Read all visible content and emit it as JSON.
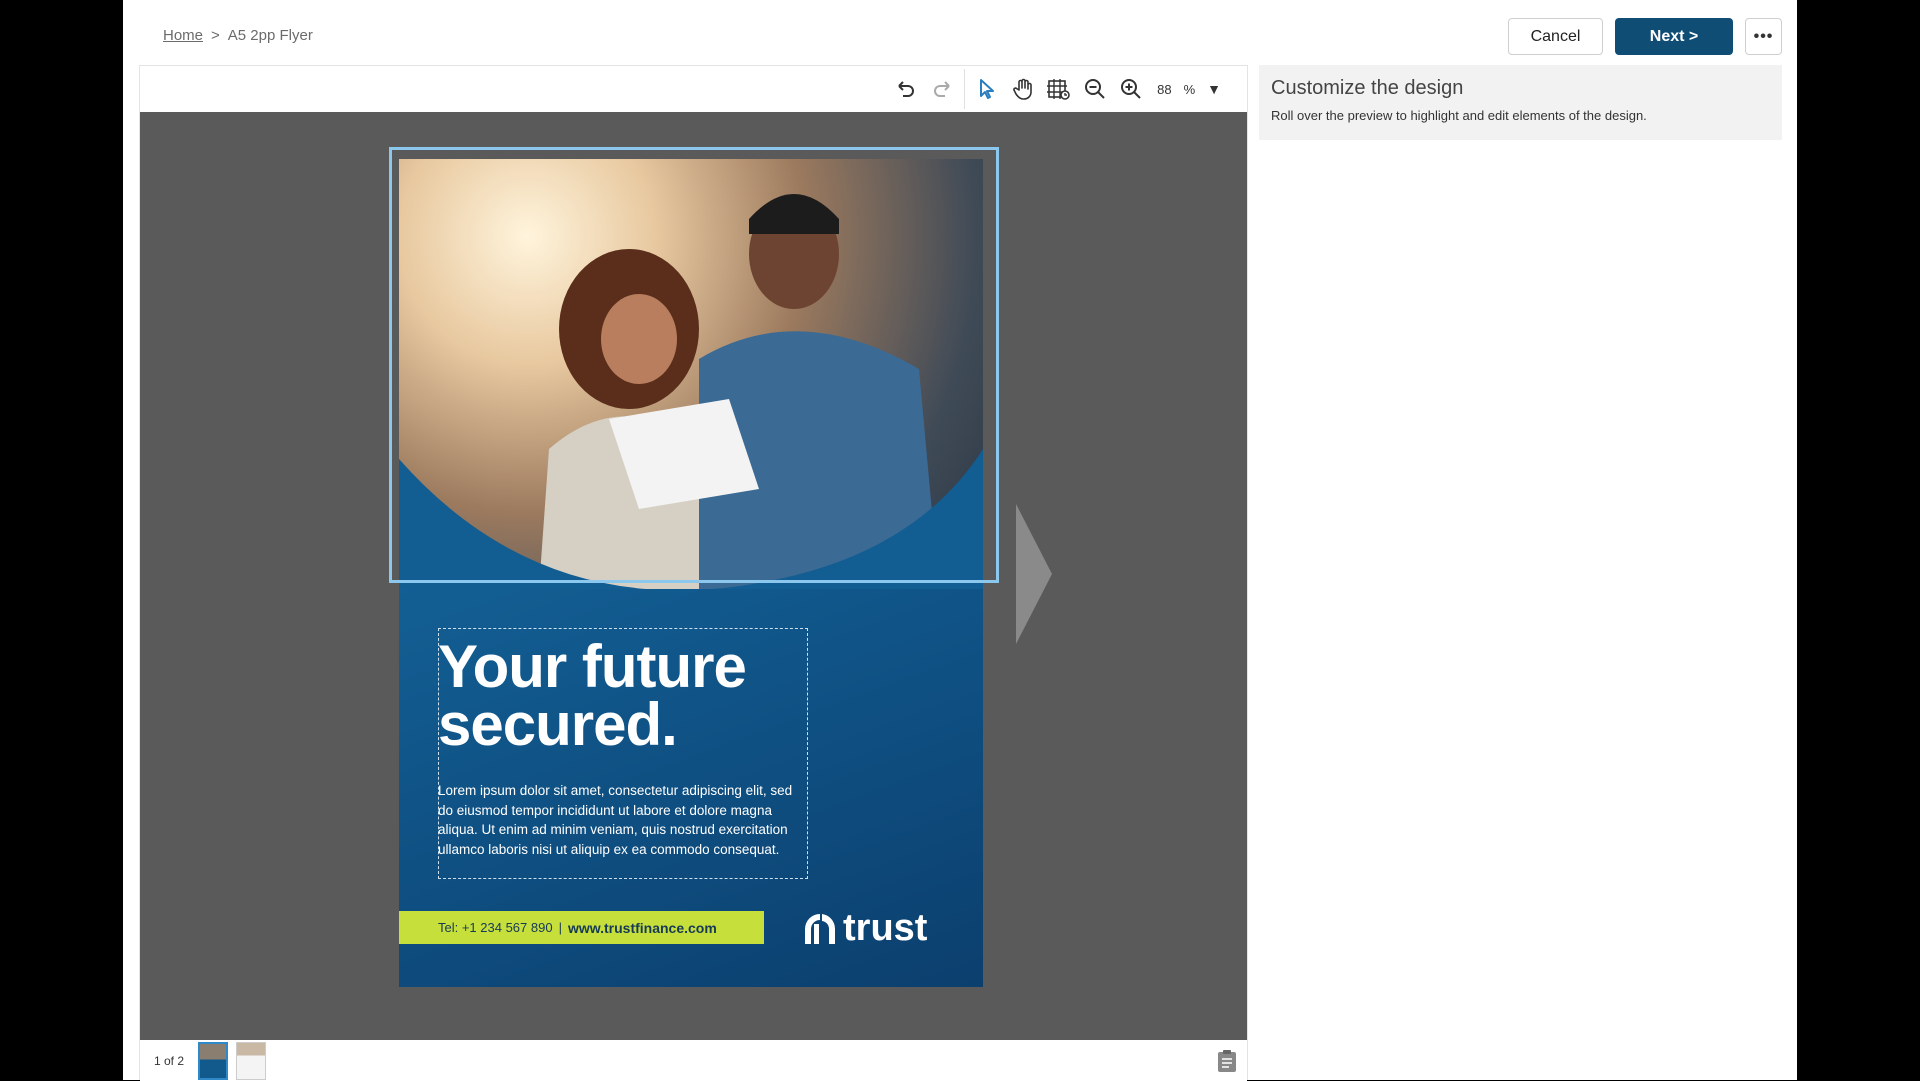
{
  "breadcrumb": {
    "home": "Home",
    "separator": ">",
    "current": "A5 2pp Flyer"
  },
  "header": {
    "cancel_label": "Cancel",
    "next_label": "Next >",
    "more_label": "•••"
  },
  "toolbar": {
    "icons": [
      "undo-icon",
      "redo-icon",
      "pointer-icon",
      "hand-icon",
      "grid-guides-icon",
      "zoom-out-icon",
      "zoom-in-icon"
    ],
    "zoom_value": "88",
    "zoom_unit": "%",
    "zoom_caret": "▼"
  },
  "flyer": {
    "headline_line1": "Your future",
    "headline_line2": "secured.",
    "body": "Lorem ipsum dolor sit amet, consectetur adipiscing elit, sed do eiusmod tempor incididunt ut labore et dolore magna aliqua. Ut enim ad minim veniam, quis nostrud exercitation ullamco laboris nisi ut aliquip ex ea commodo consequat.",
    "phone": "Tel: +1 234 567 890",
    "separator": "|",
    "website": "www.trustfinance.com",
    "logo_text": "trust"
  },
  "footer": {
    "page_count": "1 of 2"
  },
  "panel": {
    "title": "Customize the design",
    "subtitle": "Roll over the preview to highlight and edit elements of the design."
  },
  "colors": {
    "next_button": "#0f4d74",
    "flyer_blue": "#125d92",
    "contact_bar": "#c7df3a",
    "selection": "#8cc7ee",
    "canvas_bg": "#5a5a5a"
  }
}
